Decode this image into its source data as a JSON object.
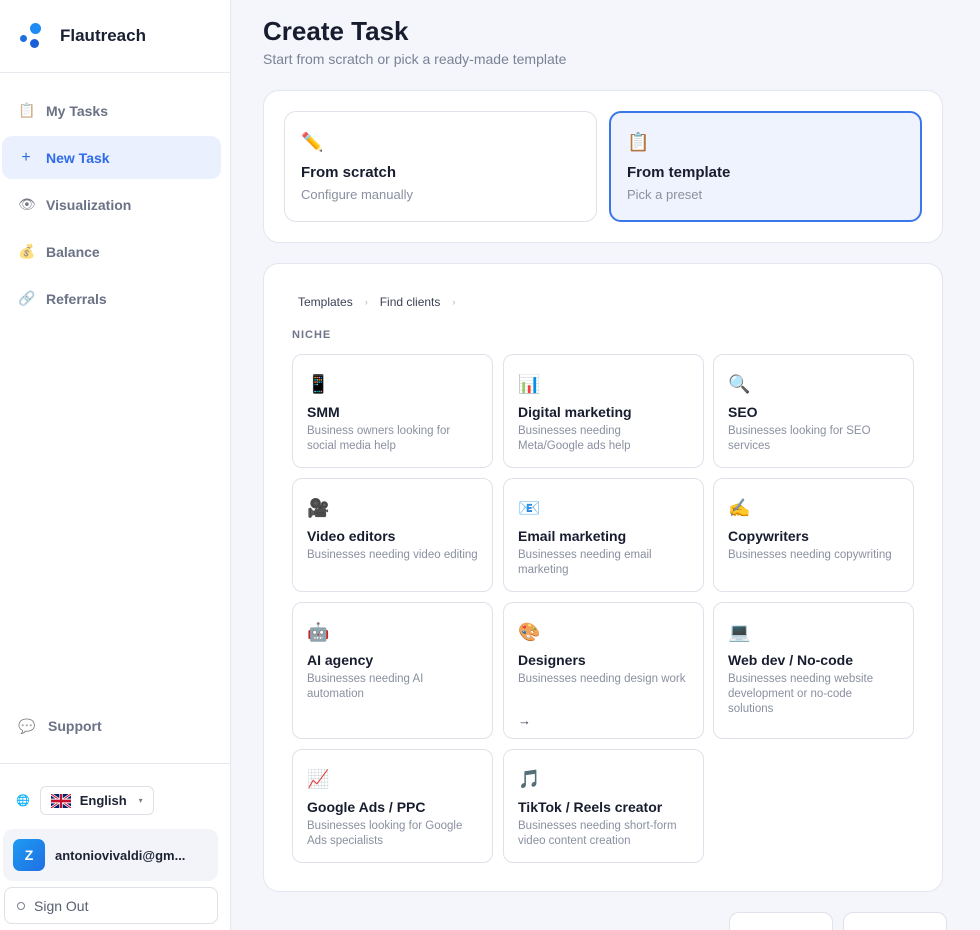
{
  "brand": {
    "name": "Flautreach"
  },
  "nav": [
    {
      "label": "My Tasks",
      "icon": "clipboard-icon",
      "glyph": "📋"
    },
    {
      "label": "New Task",
      "icon": "plus-icon",
      "glyph": "+"
    },
    {
      "label": "Visualization",
      "icon": "eye-icon",
      "glyph": "👁"
    },
    {
      "label": "Balance",
      "icon": "money-bag-icon",
      "glyph": "💰"
    },
    {
      "label": "Referrals",
      "icon": "link-icon",
      "glyph": "🔗"
    }
  ],
  "active_nav": "New Task",
  "support": {
    "label": "Support",
    "glyph": "💬"
  },
  "language": {
    "selected": "English",
    "globe": "🌐",
    "caret": "▾"
  },
  "user": {
    "initial": "Z",
    "email": "antoniovivaldi@gm..."
  },
  "signout": {
    "label": "Sign Out"
  },
  "page": {
    "title": "Create Task",
    "subtitle": "Start from scratch or pick a ready-made template"
  },
  "modes": [
    {
      "title": "From scratch",
      "subtitle": "Configure manually",
      "glyph": "✏️"
    },
    {
      "title": "From template",
      "subtitle": "Pick a preset",
      "glyph": "📋"
    }
  ],
  "breadcrumb": {
    "items": [
      "Templates",
      "Find clients"
    ],
    "sep": "›"
  },
  "section_label": "NICHE",
  "templates": [
    {
      "title": "SMM",
      "desc": "Business owners looking for social media help",
      "glyph": "📱",
      "icon": "phone-icon"
    },
    {
      "title": "Digital marketing",
      "desc": "Businesses needing Meta/Google ads help",
      "glyph": "📊",
      "icon": "bar-chart-icon"
    },
    {
      "title": "SEO",
      "desc": "Businesses looking for SEO services",
      "glyph": "🔍",
      "icon": "magnifier-icon"
    },
    {
      "title": "Video editors",
      "desc": "Businesses needing video editing",
      "glyph": "🎥",
      "icon": "camera-icon"
    },
    {
      "title": "Email marketing",
      "desc": "Businesses needing email marketing",
      "glyph": "📧",
      "icon": "email-icon"
    },
    {
      "title": "Copywriters",
      "desc": "Businesses needing copywriting",
      "glyph": "✍️",
      "icon": "writing-hand-icon"
    },
    {
      "title": "AI agency",
      "desc": "Businesses needing AI automation",
      "glyph": "🤖",
      "icon": "robot-icon"
    },
    {
      "title": "Designers",
      "desc": "Businesses needing design work",
      "glyph": "🎨",
      "icon": "palette-icon",
      "arrow": "→"
    },
    {
      "title": "Web dev / No-code",
      "desc": "Businesses needing website development or no-code solutions",
      "glyph": "💻",
      "icon": "laptop-icon"
    },
    {
      "title": "Google Ads / PPC",
      "desc": "Businesses looking for Google Ads specialists",
      "glyph": "📈",
      "icon": "trend-chart-icon"
    },
    {
      "title": "TikTok / Reels creator",
      "desc": "Businesses needing short-form video content creation",
      "glyph": "🎵",
      "icon": "music-note-icon"
    }
  ],
  "colors": {
    "accent": "#2f6bea",
    "brand_blue": "#1f8cf5",
    "active_bg": "#eaf0fd"
  }
}
